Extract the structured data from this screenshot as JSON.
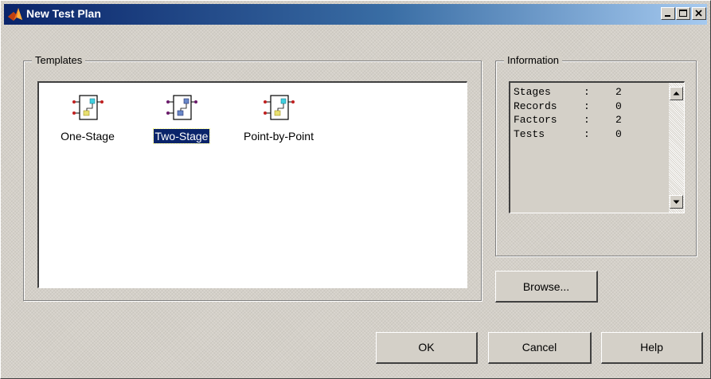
{
  "window": {
    "title": "New Test Plan",
    "controls": {
      "minimize": "minimize-icon",
      "maximize": "maximize-icon",
      "close": "close-icon"
    }
  },
  "templates": {
    "label": "Templates",
    "items": [
      {
        "label": "One-Stage",
        "icon": "one-stage-template-icon",
        "selected": false
      },
      {
        "label": "Two-Stage",
        "icon": "two-stage-template-icon",
        "selected": true
      },
      {
        "label": "Point-by-Point",
        "icon": "point-by-point-template-icon",
        "selected": false
      }
    ]
  },
  "information": {
    "label": "Information",
    "rows": [
      {
        "key": "Stages",
        "sep": ":",
        "value": "2"
      },
      {
        "key": "Records",
        "sep": ":",
        "value": "0"
      },
      {
        "key": "Factors",
        "sep": ":",
        "value": "2"
      },
      {
        "key": "Tests",
        "sep": ":",
        "value": "0"
      }
    ]
  },
  "buttons": {
    "browse": "Browse...",
    "ok": "OK",
    "cancel": "Cancel",
    "help": "Help"
  },
  "colors": {
    "titlebar_start": "#0a246a",
    "titlebar_end": "#a6caf0",
    "selection": "#0a246a",
    "icon_cyan": "#40d0e0",
    "icon_yellow": "#e8e070",
    "icon_red": "#c02020"
  }
}
